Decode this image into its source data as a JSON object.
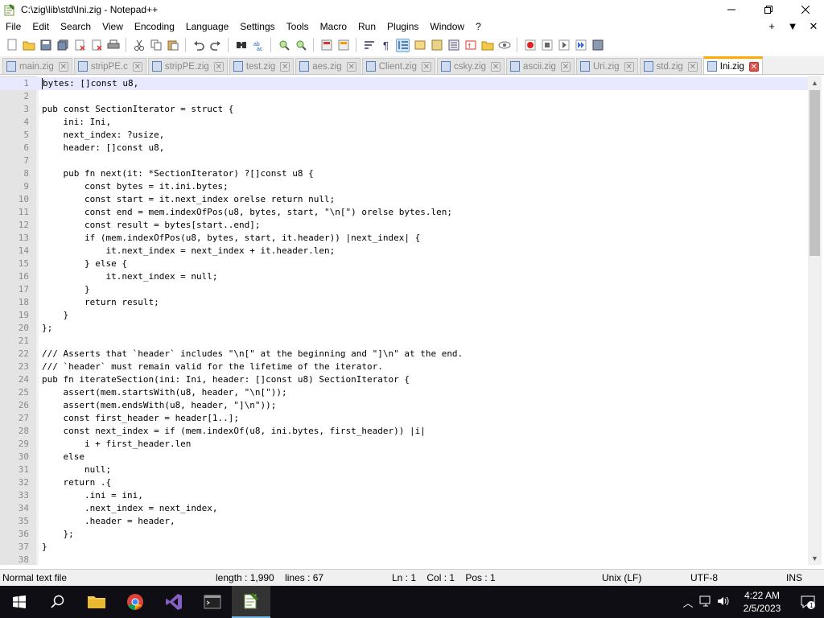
{
  "window": {
    "title": "C:\\zig\\lib\\std\\Ini.zig - Notepad++"
  },
  "menu": [
    "File",
    "Edit",
    "Search",
    "View",
    "Encoding",
    "Language",
    "Settings",
    "Tools",
    "Macro",
    "Run",
    "Plugins",
    "Window",
    "?"
  ],
  "menu_right": [
    "+",
    "▼",
    "✕"
  ],
  "tabs": [
    {
      "label": "main.zig",
      "active": false
    },
    {
      "label": "stripPE.c",
      "active": false
    },
    {
      "label": "stripPE.zig",
      "active": false
    },
    {
      "label": "test.zig",
      "active": false
    },
    {
      "label": "aes.zig",
      "active": false
    },
    {
      "label": "Client.zig",
      "active": false
    },
    {
      "label": "csky.zig",
      "active": false
    },
    {
      "label": "ascii.zig",
      "active": false
    },
    {
      "label": "Uri.zig",
      "active": false
    },
    {
      "label": "std.zig",
      "active": false
    },
    {
      "label": "Ini.zig",
      "active": true
    }
  ],
  "code_lines": [
    {
      "n": "1",
      "t": "bytes: []const u8,"
    },
    {
      "n": "2",
      "t": ""
    },
    {
      "n": "3",
      "t": "pub const SectionIterator = struct {"
    },
    {
      "n": "4",
      "t": "    ini: Ini,"
    },
    {
      "n": "5",
      "t": "    next_index: ?usize,"
    },
    {
      "n": "6",
      "t": "    header: []const u8,"
    },
    {
      "n": "7",
      "t": ""
    },
    {
      "n": "8",
      "t": "    pub fn next(it: *SectionIterator) ?[]const u8 {"
    },
    {
      "n": "9",
      "t": "        const bytes = it.ini.bytes;"
    },
    {
      "n": "10",
      "t": "        const start = it.next_index orelse return null;"
    },
    {
      "n": "11",
      "t": "        const end = mem.indexOfPos(u8, bytes, start, \"\\n[\") orelse bytes.len;"
    },
    {
      "n": "12",
      "t": "        const result = bytes[start..end];"
    },
    {
      "n": "13",
      "t": "        if (mem.indexOfPos(u8, bytes, start, it.header)) |next_index| {"
    },
    {
      "n": "14",
      "t": "            it.next_index = next_index + it.header.len;"
    },
    {
      "n": "15",
      "t": "        } else {"
    },
    {
      "n": "16",
      "t": "            it.next_index = null;"
    },
    {
      "n": "17",
      "t": "        }"
    },
    {
      "n": "18",
      "t": "        return result;"
    },
    {
      "n": "19",
      "t": "    }"
    },
    {
      "n": "20",
      "t": "};"
    },
    {
      "n": "21",
      "t": ""
    },
    {
      "n": "22",
      "t": "/// Asserts that `header` includes \"\\n[\" at the beginning and \"]\\n\" at the end."
    },
    {
      "n": "23",
      "t": "/// `header` must remain valid for the lifetime of the iterator."
    },
    {
      "n": "24",
      "t": "pub fn iterateSection(ini: Ini, header: []const u8) SectionIterator {"
    },
    {
      "n": "25",
      "t": "    assert(mem.startsWith(u8, header, \"\\n[\"));"
    },
    {
      "n": "26",
      "t": "    assert(mem.endsWith(u8, header, \"]\\n\"));"
    },
    {
      "n": "27",
      "t": "    const first_header = header[1..];"
    },
    {
      "n": "28",
      "t": "    const next_index = if (mem.indexOf(u8, ini.bytes, first_header)) |i|"
    },
    {
      "n": "29",
      "t": "        i + first_header.len"
    },
    {
      "n": "30",
      "t": "    else"
    },
    {
      "n": "31",
      "t": "        null;"
    },
    {
      "n": "32",
      "t": "    return .{"
    },
    {
      "n": "33",
      "t": "        .ini = ini,"
    },
    {
      "n": "34",
      "t": "        .next_index = next_index,"
    },
    {
      "n": "35",
      "t": "        .header = header,"
    },
    {
      "n": "36",
      "t": "    };"
    },
    {
      "n": "37",
      "t": "}"
    },
    {
      "n": "38",
      "t": ""
    }
  ],
  "status": {
    "type": "Normal text file",
    "length": "length : 1,990    lines : 67",
    "position": "Ln : 1    Col : 1    Pos : 1",
    "eol": "Unix (LF)",
    "encoding": "UTF-8",
    "mode": "INS"
  },
  "clock": {
    "time": "4:22 AM",
    "date": "2/5/2023"
  },
  "notifications": {
    "count": "1"
  },
  "colors": {
    "active_tab_accent": "#ffaa00",
    "close_red": "#e0504a",
    "current_line": "#e8e8ff",
    "taskbar": "#0e0e14"
  }
}
